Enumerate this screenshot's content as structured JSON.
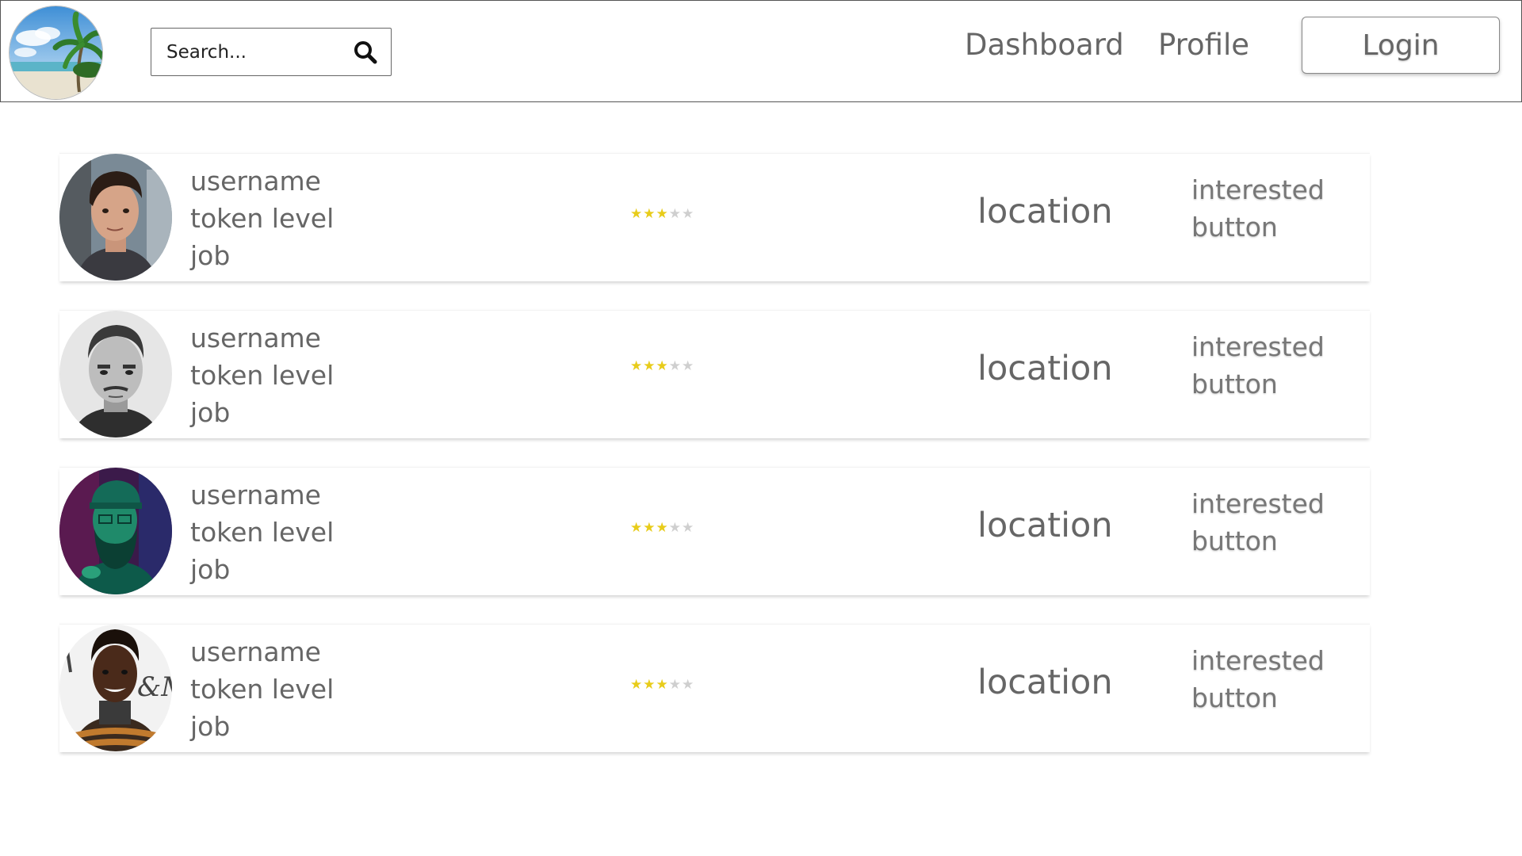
{
  "header": {
    "logo_icon": "beach-palm-logo",
    "search": {
      "placeholder": "Search...",
      "value": "",
      "icon": "search-icon"
    },
    "nav": {
      "dashboard_label": "Dashboard",
      "profile_label": "Profile"
    },
    "login_label": "Login"
  },
  "colors": {
    "star_filled": "#e8cc1a",
    "star_empty": "#cfcfcf",
    "text": "#666666",
    "border": "#555555"
  },
  "users": [
    {
      "avatar": "young-man-portrait",
      "username": "username",
      "token_level": "token level",
      "job": "job",
      "rating": 3,
      "rating_max": 5,
      "location": "location",
      "interested_label": "interested button"
    },
    {
      "avatar": "mustached-man-bw-portrait",
      "username": "username",
      "token_level": "token level",
      "job": "job",
      "rating": 3,
      "rating_max": 5,
      "location": "location",
      "interested_label": "interested button"
    },
    {
      "avatar": "bearded-man-neon-portrait",
      "username": "username",
      "token_level": "token level",
      "job": "job",
      "rating": 3,
      "rating_max": 5,
      "location": "location",
      "interested_label": "interested button"
    },
    {
      "avatar": "woman-striped-sweater-portrait",
      "username": "username",
      "token_level": "token level",
      "job": "job",
      "rating": 3,
      "rating_max": 5,
      "location": "location",
      "interested_label": "interested button"
    }
  ]
}
